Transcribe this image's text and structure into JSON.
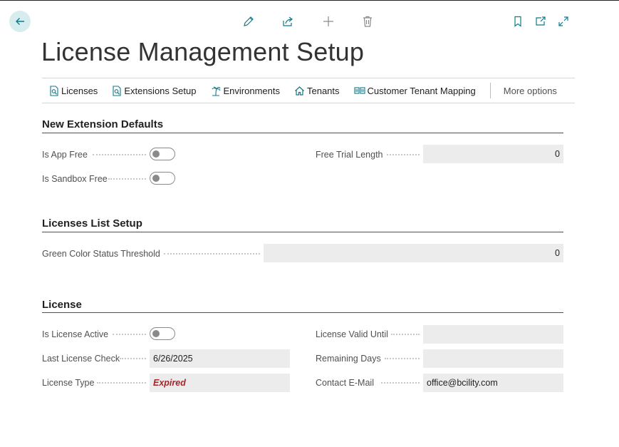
{
  "page": {
    "title": "License Management Setup"
  },
  "toolbar": {
    "back_icon": "arrow-left-icon",
    "icons": [
      "edit-icon",
      "share-icon",
      "new-icon",
      "delete-icon",
      "bookmark-icon",
      "open-new-window-icon",
      "expand-icon"
    ]
  },
  "actions": [
    {
      "label": "Licenses",
      "icon": "document-search-icon"
    },
    {
      "label": "Extensions Setup",
      "icon": "document-search-icon"
    },
    {
      "label": "Environments",
      "icon": "palm-tree-icon"
    },
    {
      "label": "Tenants",
      "icon": "home-icon"
    },
    {
      "label": "Customer Tenant Mapping",
      "icon": "mapping-icon"
    }
  ],
  "more_options": "More options",
  "sections": {
    "new_extension_defaults": {
      "title": "New Extension Defaults",
      "is_app_free": {
        "label": "Is App Free",
        "value": false
      },
      "is_sandbox_free": {
        "label": "Is Sandbox Free",
        "value": false
      },
      "free_trial_length": {
        "label": "Free Trial Length",
        "value": "0"
      }
    },
    "licenses_list_setup": {
      "title": "Licenses List Setup",
      "green_color_status_threshold": {
        "label": "Green Color Status Threshold",
        "value": "0"
      }
    },
    "license": {
      "title": "License",
      "is_license_active": {
        "label": "Is License Active",
        "value": false
      },
      "last_license_check": {
        "label": "Last License Check",
        "value": "6/26/2025"
      },
      "license_type": {
        "label": "License Type",
        "value": "Expired"
      },
      "license_valid_until": {
        "label": "License Valid Until",
        "value": ""
      },
      "remaining_days": {
        "label": "Remaining Days",
        "value": ""
      },
      "contact_email": {
        "label": "Contact E-Mail",
        "value": "office@bcility.com"
      }
    }
  },
  "colors": {
    "accent": "#0f7b8c",
    "back_button_bg": "#d7ecef",
    "expired_text": "#a4262c",
    "field_bg": "#ececec"
  }
}
